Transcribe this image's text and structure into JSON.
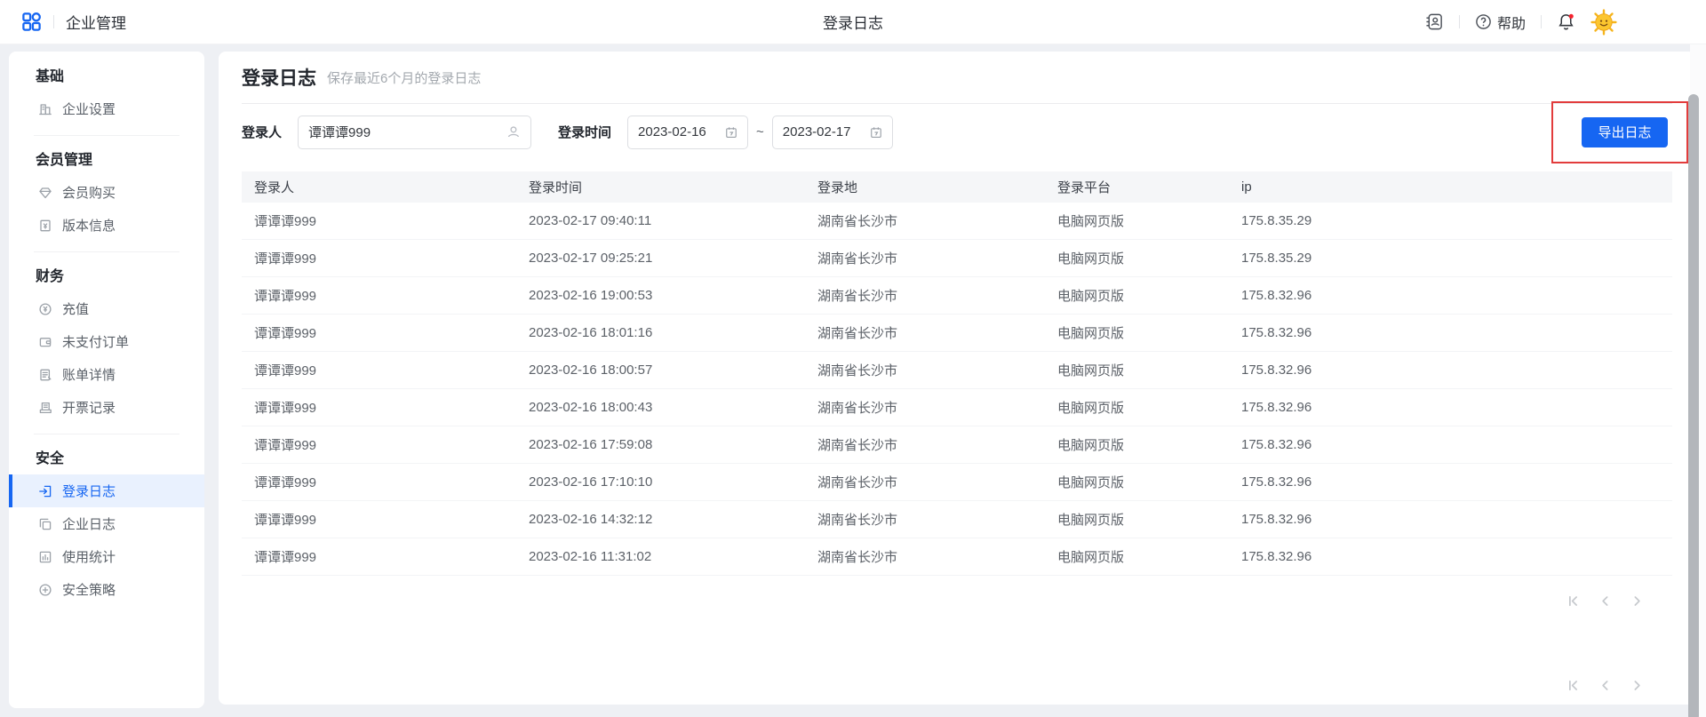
{
  "topbar": {
    "app_title": "企业管理",
    "page_title": "登录日志",
    "help_label": "帮助",
    "icons": [
      "apps-grid-icon",
      "contacts-icon",
      "help-icon",
      "notification-bell-icon",
      "avatar-sun"
    ]
  },
  "sidebar": {
    "sections": [
      {
        "heading": "基础",
        "items": [
          {
            "label": "企业设置",
            "icon": "building-icon",
            "active": false
          }
        ]
      },
      {
        "heading": "会员管理",
        "items": [
          {
            "label": "会员购买",
            "icon": "membership-diamond-icon",
            "active": false
          },
          {
            "label": "版本信息",
            "icon": "version-info-icon",
            "active": false
          }
        ]
      },
      {
        "heading": "财务",
        "items": [
          {
            "label": "充值",
            "icon": "recharge-icon",
            "active": false
          },
          {
            "label": "未支付订单",
            "icon": "unpaid-orders-icon",
            "active": false
          },
          {
            "label": "账单详情",
            "icon": "bill-details-icon",
            "active": false
          },
          {
            "label": "开票记录",
            "icon": "invoice-records-icon",
            "active": false
          }
        ]
      },
      {
        "heading": "安全",
        "items": [
          {
            "label": "登录日志",
            "icon": "login-log-icon",
            "active": true
          },
          {
            "label": "企业日志",
            "icon": "company-log-icon",
            "active": false
          },
          {
            "label": "使用统计",
            "icon": "usage-stats-icon",
            "active": false
          },
          {
            "label": "安全策略",
            "icon": "security-policy-icon",
            "active": false
          }
        ]
      }
    ]
  },
  "main": {
    "title": "登录日志",
    "subtitle": "保存最近6个月的登录日志",
    "filters": {
      "user_label": "登录人",
      "user_value": "谭谭谭999",
      "time_label": "登录时间",
      "date_start": "2023-02-16",
      "separator": "~",
      "date_end": "2023-02-17",
      "export_label": "导出日志"
    },
    "table": {
      "columns": [
        "登录人",
        "登录时间",
        "登录地",
        "登录平台",
        "ip"
      ],
      "rows": [
        [
          "谭谭谭999",
          "2023-02-17 09:40:11",
          "湖南省长沙市",
          "电脑网页版",
          "175.8.35.29"
        ],
        [
          "谭谭谭999",
          "2023-02-17 09:25:21",
          "湖南省长沙市",
          "电脑网页版",
          "175.8.35.29"
        ],
        [
          "谭谭谭999",
          "2023-02-16 19:00:53",
          "湖南省长沙市",
          "电脑网页版",
          "175.8.32.96"
        ],
        [
          "谭谭谭999",
          "2023-02-16 18:01:16",
          "湖南省长沙市",
          "电脑网页版",
          "175.8.32.96"
        ],
        [
          "谭谭谭999",
          "2023-02-16 18:00:57",
          "湖南省长沙市",
          "电脑网页版",
          "175.8.32.96"
        ],
        [
          "谭谭谭999",
          "2023-02-16 18:00:43",
          "湖南省长沙市",
          "电脑网页版",
          "175.8.32.96"
        ],
        [
          "谭谭谭999",
          "2023-02-16 17:59:08",
          "湖南省长沙市",
          "电脑网页版",
          "175.8.32.96"
        ],
        [
          "谭谭谭999",
          "2023-02-16 17:10:10",
          "湖南省长沙市",
          "电脑网页版",
          "175.8.32.96"
        ],
        [
          "谭谭谭999",
          "2023-02-16 14:32:12",
          "湖南省长沙市",
          "电脑网页版",
          "175.8.32.96"
        ],
        [
          "谭谭谭999",
          "2023-02-16 11:31:02",
          "湖南省长沙市",
          "电脑网页版",
          "175.8.32.96"
        ]
      ]
    },
    "pagination": {
      "buttons": [
        "first-page-icon",
        "prev-page-icon",
        "next-page-icon"
      ]
    }
  },
  "colors": {
    "accent": "#1666f2",
    "annotation_box": "#e23c3c",
    "active_item_bg": "#e9f1fe",
    "notification_dot": "#f5222d",
    "page_background": "#eef0f4"
  }
}
